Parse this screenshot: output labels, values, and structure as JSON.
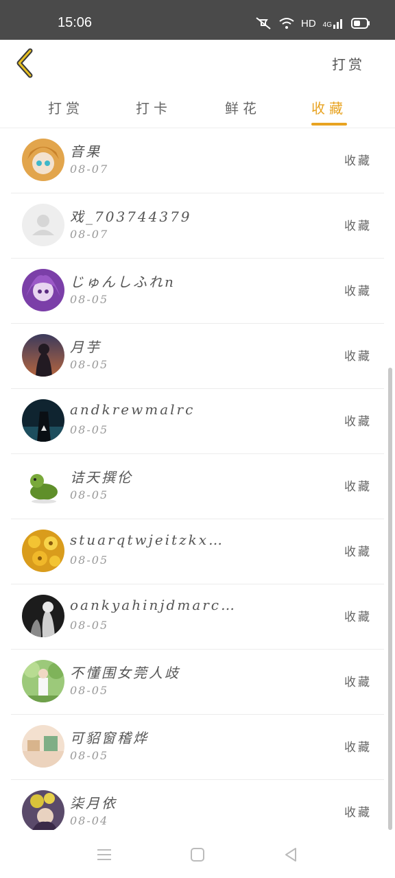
{
  "status_bar": {
    "time": "15:06",
    "network_label": "HD",
    "signal_label": "4G"
  },
  "header": {
    "right_action": "打赏"
  },
  "tabs": [
    {
      "label": "打赏",
      "active": false
    },
    {
      "label": "打卡",
      "active": false
    },
    {
      "label": "鲜花",
      "active": false
    },
    {
      "label": "收藏",
      "active": true
    }
  ],
  "accent_color": "#e8a321",
  "list": [
    {
      "name": "音果",
      "date": "08-07",
      "action": "收藏",
      "avatar": "anime-girl-avatar"
    },
    {
      "name": "戏_703744379",
      "date": "08-07",
      "action": "收藏",
      "avatar": "default-user-avatar"
    },
    {
      "name": "じゅんしふれn",
      "date": "08-05",
      "action": "收藏",
      "avatar": "purple-anime-avatar"
    },
    {
      "name": "月芋",
      "date": "08-05",
      "action": "收藏",
      "avatar": "sunset-avatar"
    },
    {
      "name": "andkrewmalrc",
      "date": "08-05",
      "action": "收藏",
      "avatar": "dark-figure-avatar"
    },
    {
      "name": "诘天撰伦",
      "date": "08-05",
      "action": "收藏",
      "avatar": "green-turtle-avatar"
    },
    {
      "name": "stuarqtwjeitzkxm ···",
      "date": "08-05",
      "action": "收藏",
      "avatar": "yellow-flowers-avatar"
    },
    {
      "name": "oankyahinjdmarcha",
      "date": "08-05",
      "action": "收藏",
      "avatar": "bw-photo-avatar"
    },
    {
      "name": "不懂围女莞人歧",
      "date": "08-05",
      "action": "收藏",
      "avatar": "garden-person-avatar"
    },
    {
      "name": "可貂窗稽烨",
      "date": "08-05",
      "action": "收藏",
      "avatar": "still-life-avatar"
    },
    {
      "name": "柒月依",
      "date": "08-04",
      "action": "收藏",
      "avatar": "flower-girl-avatar"
    }
  ]
}
